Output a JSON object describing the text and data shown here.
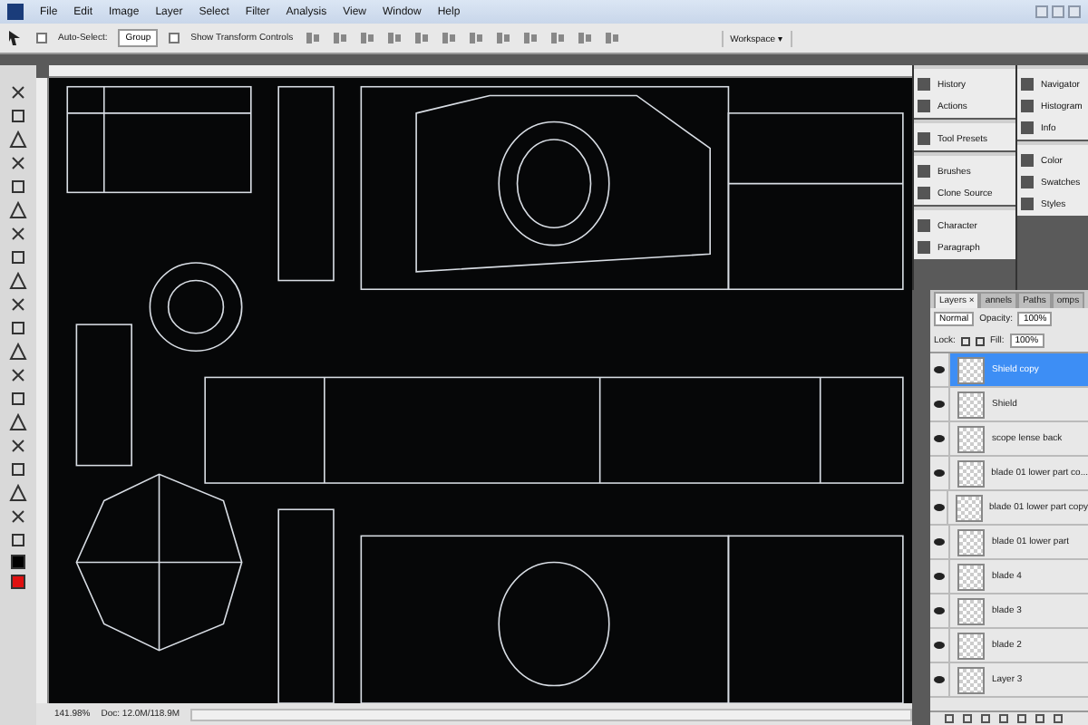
{
  "menu": [
    "File",
    "Edit",
    "Image",
    "Layer",
    "Select",
    "Filter",
    "Analysis",
    "View",
    "Window",
    "Help"
  ],
  "options_bar": {
    "auto_select": {
      "label": "Auto-Select:",
      "checked": false
    },
    "auto_select_mode": "Group",
    "show_transform": {
      "label": "Show Transform Controls",
      "checked": false
    },
    "workspace": "Workspace ▾"
  },
  "dock": {
    "column_1": [
      [
        "History",
        "Actions"
      ],
      [
        "Tool Presets"
      ],
      [
        "Brushes",
        "Clone Source"
      ],
      [
        "Character",
        "Paragraph"
      ]
    ],
    "column_2": [
      [
        "Navigator",
        "Histogram",
        "Info"
      ],
      [
        "Color",
        "Swatches",
        "Styles"
      ]
    ]
  },
  "layers_panel": {
    "tabs": [
      {
        "label": "Layers",
        "selected": true
      },
      {
        "label": "annels",
        "selected": false
      },
      {
        "label": "Paths",
        "selected": false
      },
      {
        "label": "omps",
        "selected": false
      }
    ],
    "close": "×",
    "blend_mode": "Normal",
    "opacity_label": "Opacity:",
    "opacity": "100%",
    "lock_label": "Lock:",
    "fill_label": "Fill:",
    "fill": "100%",
    "layers": [
      {
        "name": "Shield copy",
        "visible": true,
        "selected": true
      },
      {
        "name": "Shield",
        "visible": true,
        "selected": false
      },
      {
        "name": "scope lense back",
        "visible": true,
        "selected": false
      },
      {
        "name": "blade 01 lower part co...",
        "visible": true,
        "selected": false
      },
      {
        "name": "blade 01 lower part copy",
        "visible": true,
        "selected": false
      },
      {
        "name": "blade 01 lower part",
        "visible": true,
        "selected": false
      },
      {
        "name": "blade 4",
        "visible": true,
        "selected": false
      },
      {
        "name": "blade 3",
        "visible": true,
        "selected": false
      },
      {
        "name": "blade 2",
        "visible": true,
        "selected": false
      },
      {
        "name": "Layer 3",
        "visible": true,
        "selected": false
      }
    ]
  },
  "status_bar": {
    "zoom": "141.98%",
    "doc": "Doc: 12.0M/118.9M"
  }
}
